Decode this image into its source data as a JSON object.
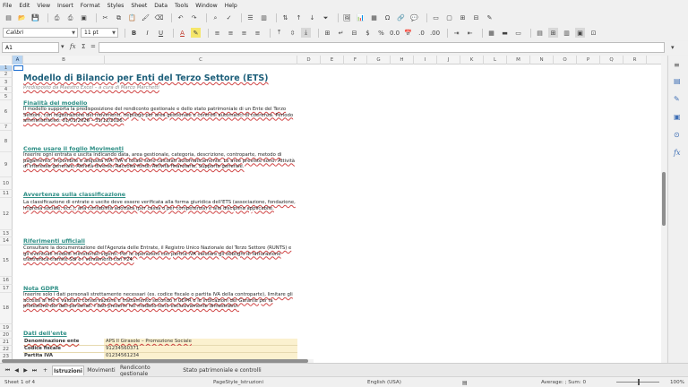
{
  "menu": [
    "File",
    "Edit",
    "View",
    "Insert",
    "Format",
    "Styles",
    "Sheet",
    "Data",
    "Tools",
    "Window",
    "Help"
  ],
  "toolbar": {
    "font_name": "Calibri",
    "font_size": "11 pt"
  },
  "formula_bar": {
    "cell_ref": "A1",
    "fx_label": "fx",
    "sum_label": "Σ",
    "equals_label": "=",
    "value": ""
  },
  "columns": [
    "A",
    "B",
    "C",
    "D",
    "E",
    "F",
    "G",
    "H",
    "I",
    "J",
    "K",
    "L",
    "M",
    "N",
    "O",
    "P",
    "Q",
    "R"
  ],
  "rows": [
    "1",
    "2",
    "3",
    "4",
    "5",
    "6",
    "7",
    "8",
    "9",
    "10",
    "11",
    "12",
    "13",
    "14",
    "15",
    "16",
    "17",
    "18",
    "19",
    "20",
    "21",
    "22",
    "23"
  ],
  "content": {
    "title": "Modello di Bilancio per Enti del Terzo Settore (ETS)",
    "subtitle": "Predisposto da Maestro Excel – a cura di Marco Marchetti",
    "section1_title": "Finalità del modello",
    "section1_text": "Il modello supporta la predisposizione del rendiconto gestionale e dello stato patrimoniale di un Ente del Terzo Settore, con registrazione dei movimenti, riepilogo per area gestionale e controlli automatici di coerenza. Periodo amministrativo: 01/01/2026 – 31/12/2026.",
    "section2_title": "Come usare il foglio Movimenti",
    "section2_text": "Inserire ogni entrata e uscita indicando data, area gestionale, categoria, descrizione, controparte, metodo di pagamento, imponibile e aliquota IVA. IVA e totale sono calcolati automaticamente. Le aree previste sono: Attività di interesse generale, Attività diverse, Raccolta fondi, Attività finanziarie, Supporto generale.",
    "section3_title": "Avvertenze sulla classificazione",
    "section3_text": "La classificazione di entrate e uscite deve essere verificata alla forma giuridica dell'ETS (associazione, fondazione, impresa sociale, ecc.), alla contabilità adottata (per cassa o per competenza) e alla disciplina applicabile.",
    "section4_title": "Riferimenti ufficiali",
    "section4_text": "Consultare la documentazione dell'Agenzia delle Entrate, il Registro Unico Nazionale del Terzo Settore (RUNTS) e gli eventuali modelli ministeriali vigenti. Per le operazioni con partita IVA valutare gli obblighi di fatturazione elettronica tramite SdI e i versamenti con F24.",
    "section5_title": "Nota GDPR",
    "section5_text": "Inserire solo i dati personali strettamente necessari (es. codice fiscale o partita IVA della controparte), limitare gli accessi al file e valutare conservazione e trattamento secondo il GDPR e le indicazioni del Garante per la protezione dei dati personali. I dati presenti nel modello sono esclusivamente dimostrativi.",
    "section6_title": "Dati dell'ente",
    "entity_rows": [
      {
        "key": "Denominazione ente",
        "value": "APS Il Girasole – Promozione Sociale"
      },
      {
        "key": "Codice fiscale",
        "value": "91234560371"
      },
      {
        "key": "Partita IVA",
        "value": "01234561234"
      }
    ]
  },
  "sheet_tabs": [
    "Istruzioni",
    "Movimenti",
    "Rendiconto gestionale",
    "Stato patrimoniale e controlli"
  ],
  "status": {
    "sheet": "Sheet 1 of 4",
    "page_style": "PageStyle_Istruzioni",
    "language": "English (USA)",
    "summary": "Average: ; Sum: 0",
    "zoom": "100%"
  },
  "accent": "#2f8f86"
}
